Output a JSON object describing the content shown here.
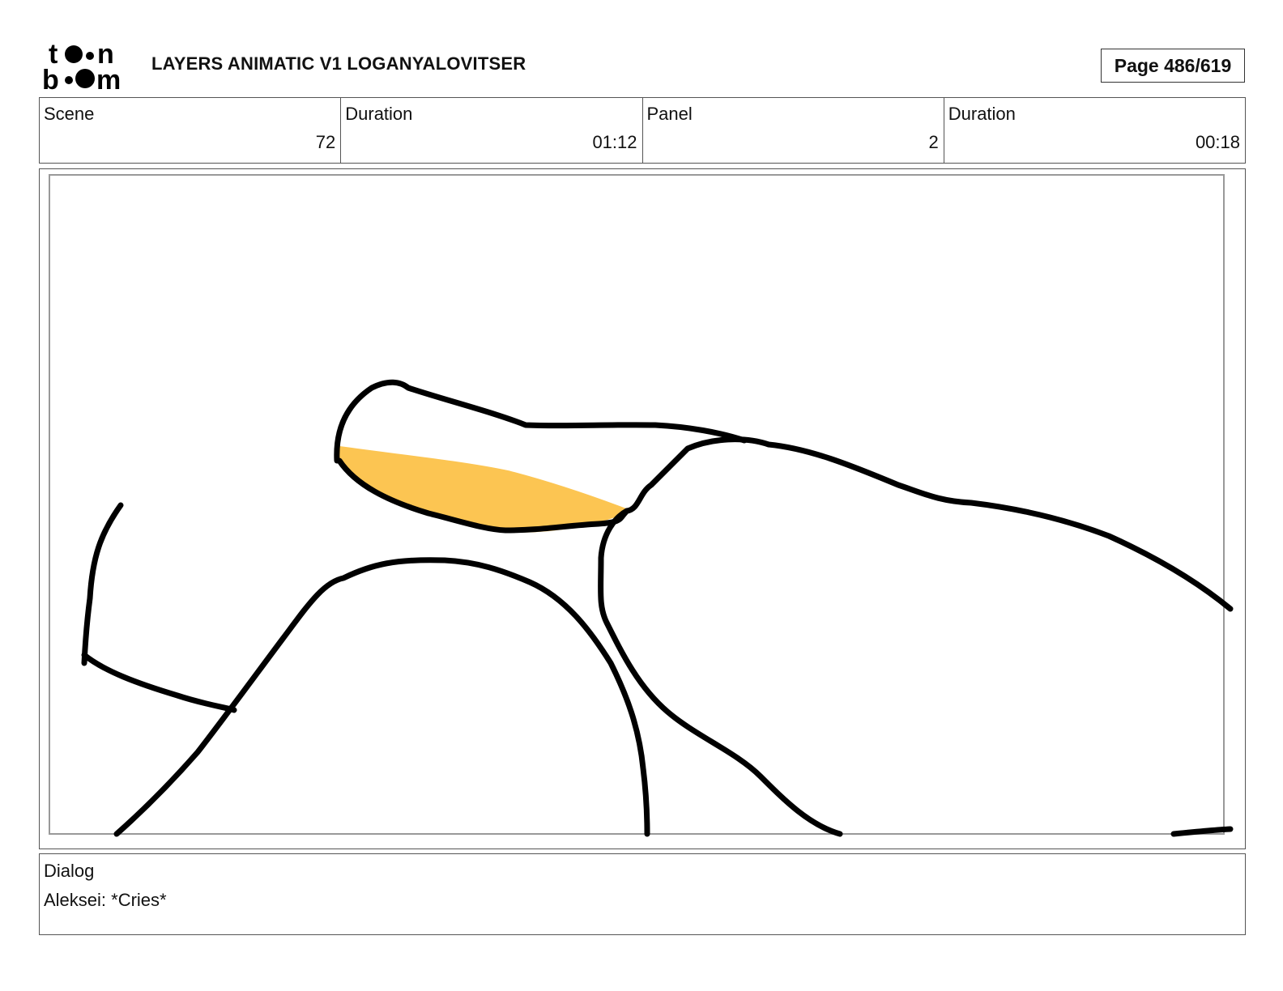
{
  "header": {
    "logo_icon": "toon-boom-logo",
    "title": "LAYERS ANIMATIC V1 LOGANYALOVITSER",
    "page_label": "Page 486/619"
  },
  "info": {
    "scene_label": "Scene",
    "scene_value": "72",
    "scene_duration_label": "Duration",
    "scene_duration_value": "01:12",
    "panel_label": "Panel",
    "panel_value": "2",
    "panel_duration_label": "Duration",
    "panel_duration_value": "00:18"
  },
  "panel": {
    "drawing": "sketch",
    "highlight_color": "#fcc552",
    "line_color": "#000000"
  },
  "dialog": {
    "label": "Dialog",
    "text": "Aleksei: *Cries*"
  }
}
